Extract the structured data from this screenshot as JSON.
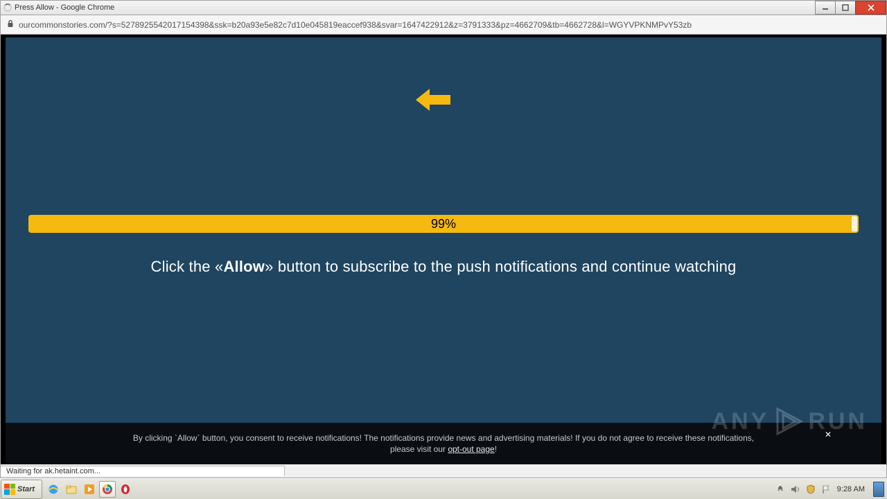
{
  "window": {
    "title": "Press Allow - Google Chrome"
  },
  "address": {
    "url": "ourcommonstories.com/?s=5278925542017154398&ssk=b20a93e5e82c7d10e045819eaccef938&svar=1647422912&z=3791333&pz=4662709&tb=4662728&l=WGYVPKNMPvY53zb"
  },
  "page": {
    "progress_pct": "99%",
    "instruction_pre": "Click the «",
    "instruction_allow": "Allow",
    "instruction_post": "» button to subscribe to the push notifications and continue watching"
  },
  "consent": {
    "line1": "By clicking `Allow` button, you consent to receive notifications! The notifications provide news and advertising materials! If you do not agree to receive these notifications,",
    "line2_pre": "please visit our ",
    "optout": "opt-out page",
    "line2_post": "!"
  },
  "status": {
    "message": "Waiting for ak.hetaint.com..."
  },
  "taskbar": {
    "start": "Start",
    "clock": "9:28 AM"
  },
  "watermark": {
    "left": "ANY",
    "right": "RUN"
  }
}
